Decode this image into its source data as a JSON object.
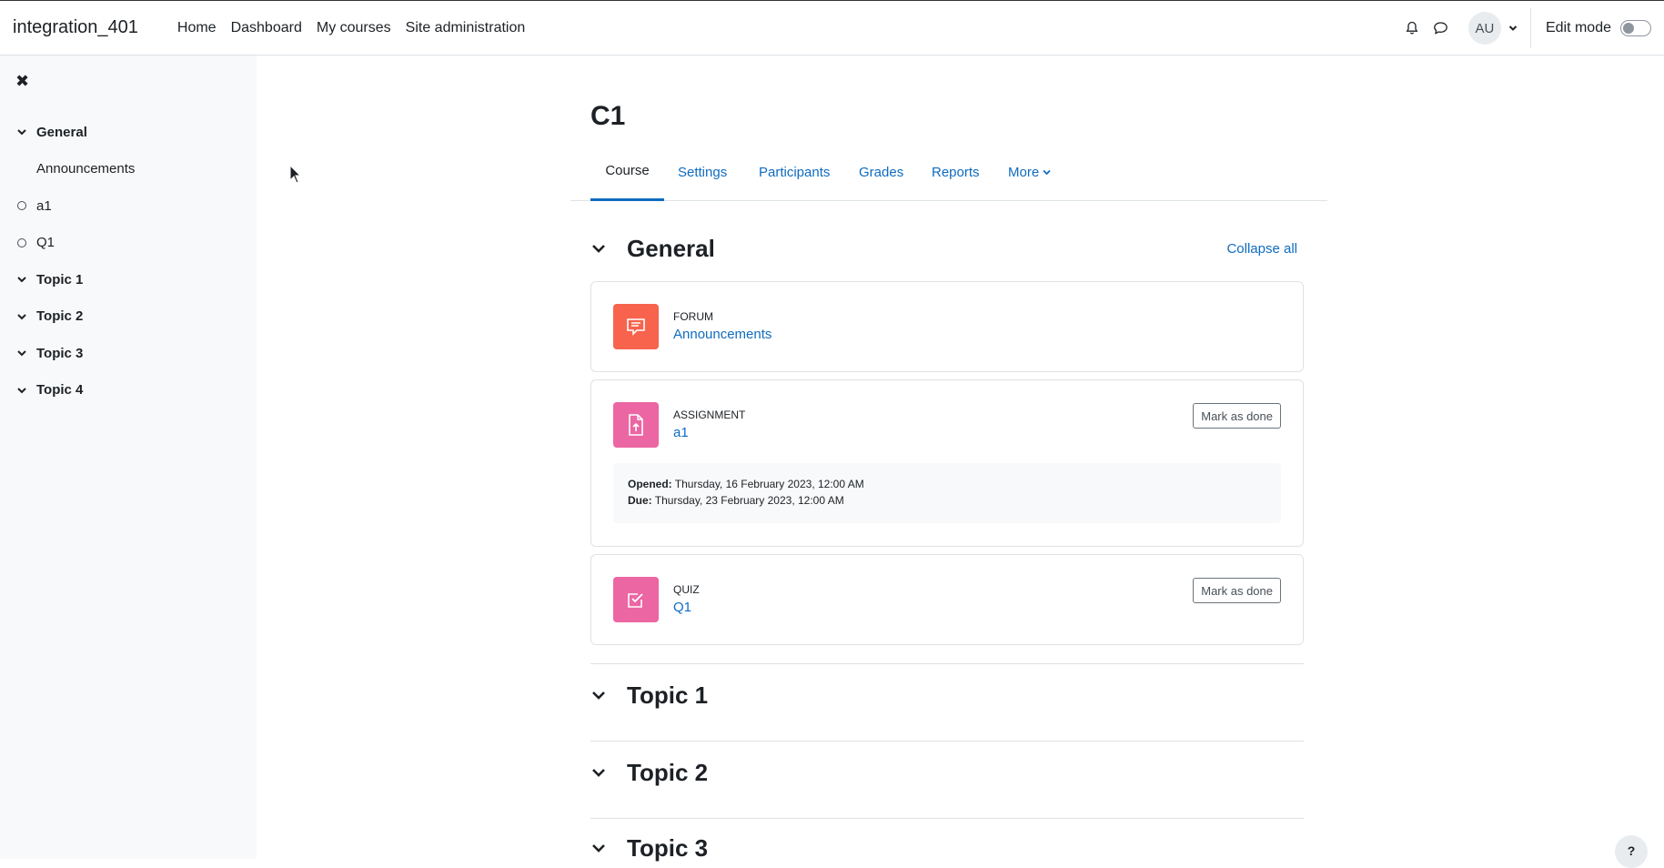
{
  "site_name": "integration_401",
  "primary_nav": [
    "Home",
    "Dashboard",
    "My courses",
    "Site administration"
  ],
  "user": {
    "initials": "AU"
  },
  "edit_mode_label": "Edit mode",
  "drawer": {
    "close_icon": "close-icon",
    "items": [
      {
        "label": "General",
        "kind": "section"
      },
      {
        "label": "Announcements",
        "kind": "child"
      },
      {
        "label": "a1",
        "kind": "activity"
      },
      {
        "label": "Q1",
        "kind": "activity"
      },
      {
        "label": "Topic 1",
        "kind": "section"
      },
      {
        "label": "Topic 2",
        "kind": "section"
      },
      {
        "label": "Topic 3",
        "kind": "section"
      },
      {
        "label": "Topic 4",
        "kind": "section"
      }
    ]
  },
  "course": {
    "title": "C1",
    "tabs": [
      "Course",
      "Settings",
      "Participants",
      "Grades",
      "Reports",
      "More"
    ],
    "active_tab": "Course"
  },
  "general_section": {
    "title": "General",
    "collapse_all": "Collapse all"
  },
  "activities": [
    {
      "type": "FORUM",
      "name": "Announcements",
      "color": "#f7634d",
      "icon": "forum-icon"
    },
    {
      "type": "ASSIGNMENT",
      "name": "a1",
      "color": "#eb66a2",
      "icon": "assignment-icon",
      "mark_done": "Mark as done",
      "opened_label": "Opened:",
      "opened_value": "Thursday, 16 February 2023, 12:00 AM",
      "due_label": "Due:",
      "due_value": "Thursday, 23 February 2023, 12:00 AM"
    },
    {
      "type": "QUIZ",
      "name": "Q1",
      "color": "#eb66a2",
      "icon": "quiz-icon",
      "mark_done": "Mark as done"
    }
  ],
  "topics": [
    "Topic 1",
    "Topic 2",
    "Topic 3"
  ],
  "help_label": "?"
}
